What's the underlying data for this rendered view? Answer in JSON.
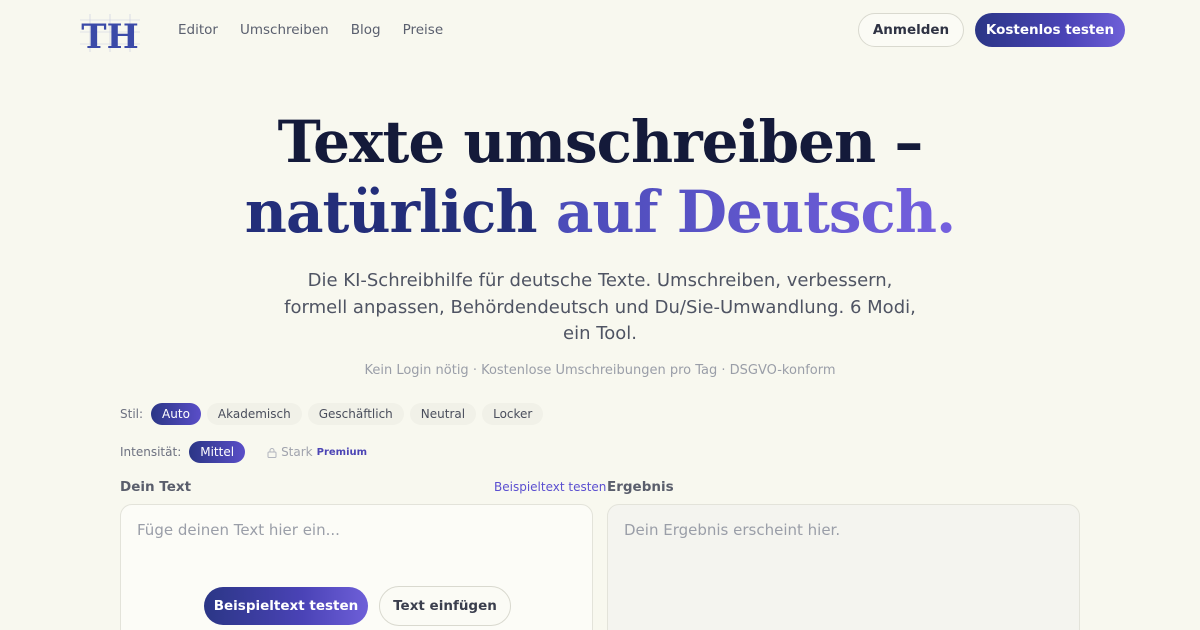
{
  "nav": {
    "logo_text": "TH",
    "links": [
      "Editor",
      "Umschreiben",
      "Blog",
      "Preise"
    ],
    "login_label": "Anmelden",
    "trial_label": "Kostenlos testen"
  },
  "hero": {
    "line1": "Texte umschreiben –",
    "line2_a": "natürlich",
    "line2_b": "auf Deutsch.",
    "subtitle": "Die KI-Schreibhilfe für deutsche Texte. Umschreiben, verbessern, formell anpassen, Behördendeutsch und Du/Sie-Umwandlung. 6 Modi, ein Tool.",
    "meta": "Kein Login nötig · Kostenlose Umschreibungen pro Tag · DSGVO-konform"
  },
  "style_selector": {
    "label": "Stil:",
    "options": [
      "Auto",
      "Akademisch",
      "Geschäftlich",
      "Neutral",
      "Locker"
    ],
    "selected": "Auto"
  },
  "intensity_selector": {
    "label": "Intensität:",
    "selected_label": "Mittel",
    "locked_label": "Stark",
    "premium_label": "Premium"
  },
  "input_panel": {
    "label": "Dein Text",
    "sample_link": "Beispieltext testen",
    "placeholder": "Füge deinen Text hier ein...",
    "sample_button": "Beispieltext testen",
    "paste_button": "Text einfügen"
  },
  "output_panel": {
    "label": "Ergebnis",
    "placeholder": "Dein Ergebnis erscheint hier."
  },
  "colors": {
    "background": "#f8f8ef",
    "navy": "#141a3a",
    "accent_start": "#2b3686",
    "accent_end": "#6e5fd8"
  }
}
